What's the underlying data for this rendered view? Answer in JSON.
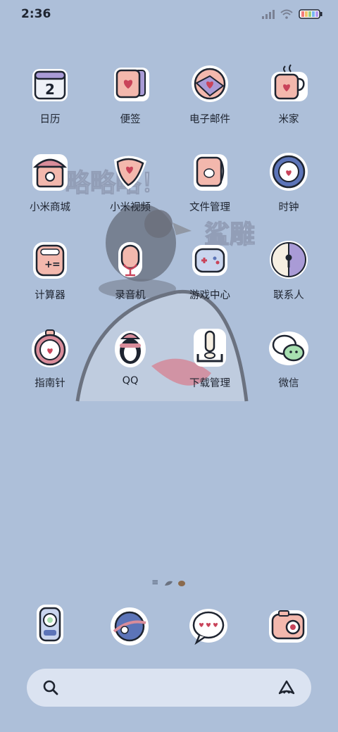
{
  "status_bar": {
    "time": "2:36",
    "icons": [
      "signal-icon",
      "wifi-icon",
      "battery-icon"
    ]
  },
  "wallpaper": {
    "text_1": "略略略！",
    "text_2": "鲨雕"
  },
  "apps": [
    {
      "label": "日历",
      "icon": "calendar-icon",
      "badge": "2"
    },
    {
      "label": "便签",
      "icon": "notes-icon"
    },
    {
      "label": "电子邮件",
      "icon": "email-icon"
    },
    {
      "label": "米家",
      "icon": "coffee-cup-icon"
    },
    {
      "label": "小米商城",
      "icon": "house-icon"
    },
    {
      "label": "小米视频",
      "icon": "video-icon"
    },
    {
      "label": "文件管理",
      "icon": "folder-icon"
    },
    {
      "label": "时钟",
      "icon": "clock-icon"
    },
    {
      "label": "计算器",
      "icon": "calculator-icon"
    },
    {
      "label": "录音机",
      "icon": "recorder-icon"
    },
    {
      "label": "游戏中心",
      "icon": "gamepad-icon"
    },
    {
      "label": "联系人",
      "icon": "contacts-icon"
    },
    {
      "label": "指南针",
      "icon": "compass-icon"
    },
    {
      "label": "QQ",
      "icon": "penguin-icon"
    },
    {
      "label": "下载管理",
      "icon": "download-icon"
    },
    {
      "label": "微信",
      "icon": "wechat-icon"
    }
  ],
  "page_indicator": "≡",
  "dock": [
    "phone-icon",
    "browser-planet-icon",
    "message-bubble-icon",
    "camera-icon"
  ],
  "search": {
    "left_icon": "search-icon",
    "right_icon": "assistant-icon"
  },
  "colors": {
    "background": "#adbfd9",
    "icon_pink": "#f3b8ad",
    "icon_purple": "#a99bd6",
    "icon_blue": "#5c74b8",
    "heart": "#c9445a"
  }
}
